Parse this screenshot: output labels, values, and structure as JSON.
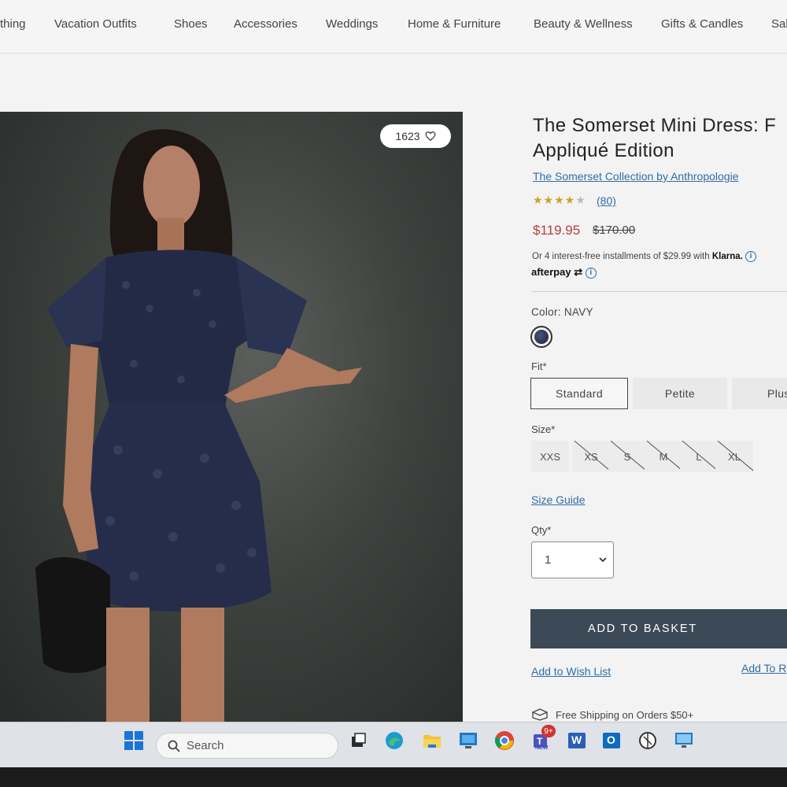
{
  "nav": {
    "items": [
      {
        "label": "thing"
      },
      {
        "label": "Vacation Outfits"
      },
      {
        "label": "Shoes"
      },
      {
        "label": "Accessories"
      },
      {
        "label": "Weddings"
      },
      {
        "label": "Home & Furniture"
      },
      {
        "label": "Beauty & Wellness"
      },
      {
        "label": "Gifts & Candles"
      },
      {
        "label": "Sal"
      }
    ]
  },
  "product": {
    "wish_count": "1623",
    "title_line1": "The Somerset Mini Dress: F",
    "title_line2": "Appliqué Edition",
    "collection": "The Somerset Collection by Anthropologie",
    "rating": 4,
    "stars_filled": "★★★★",
    "stars_empty": "★",
    "review_count": "(80)",
    "price_sale": "$119.95",
    "price_original": "$170.00",
    "installments_text": "Or 4 interest-free installments of $29.99 with ",
    "klarna": "Klarna.",
    "afterpay": "afterpay",
    "color_label": "Color: NAVY",
    "swatch_color": "#1f2642",
    "fit_label": "Fit*",
    "fit_options": [
      {
        "label": "Standard",
        "selected": true
      },
      {
        "label": "Petite",
        "selected": false
      },
      {
        "label": "Plus",
        "selected": false
      }
    ],
    "size_label": "Size*",
    "sizes": [
      {
        "label": "XXS",
        "available": true
      },
      {
        "label": "XS",
        "available": false
      },
      {
        "label": "S",
        "available": false
      },
      {
        "label": "M",
        "available": false
      },
      {
        "label": "L",
        "available": false
      },
      {
        "label": "XL",
        "available": false
      }
    ],
    "size_guide": "Size Guide",
    "qty_label": "Qty*",
    "qty_value": "1",
    "add_to_basket": "ADD TO BASKET",
    "add_to_wish_list": "Add to Wish List",
    "add_to_registry": "Add To R",
    "shipping": "Free Shipping on Orders $50+"
  },
  "taskbar": {
    "search_placeholder": "Search",
    "notification_badge": "9+",
    "teams_tag": "NEW",
    "word_letter": "W",
    "outlook_letter": "O"
  },
  "colors": {
    "link": "#2f6ea5",
    "sale_price": "#b3413e",
    "button_bg": "#3c4a57",
    "star": "#c9a227"
  }
}
